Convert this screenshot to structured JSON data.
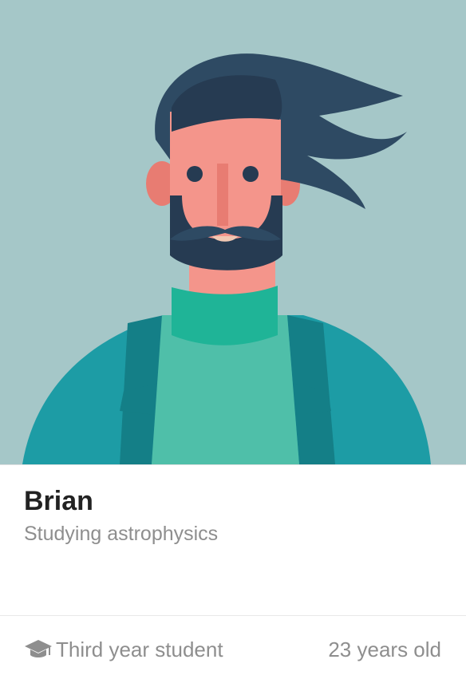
{
  "profile": {
    "name": "Brian",
    "subtitle": "Studying astrophysics"
  },
  "footer": {
    "year": "Third year student",
    "age": "23 years old",
    "year_icon": "graduation-cap-icon"
  },
  "colors": {
    "background": "#a5c7c8",
    "hair": "#2e4a63",
    "skin": "#f4958b",
    "sweater": "#1d9ca5",
    "shirt": "#4fbfa9"
  }
}
